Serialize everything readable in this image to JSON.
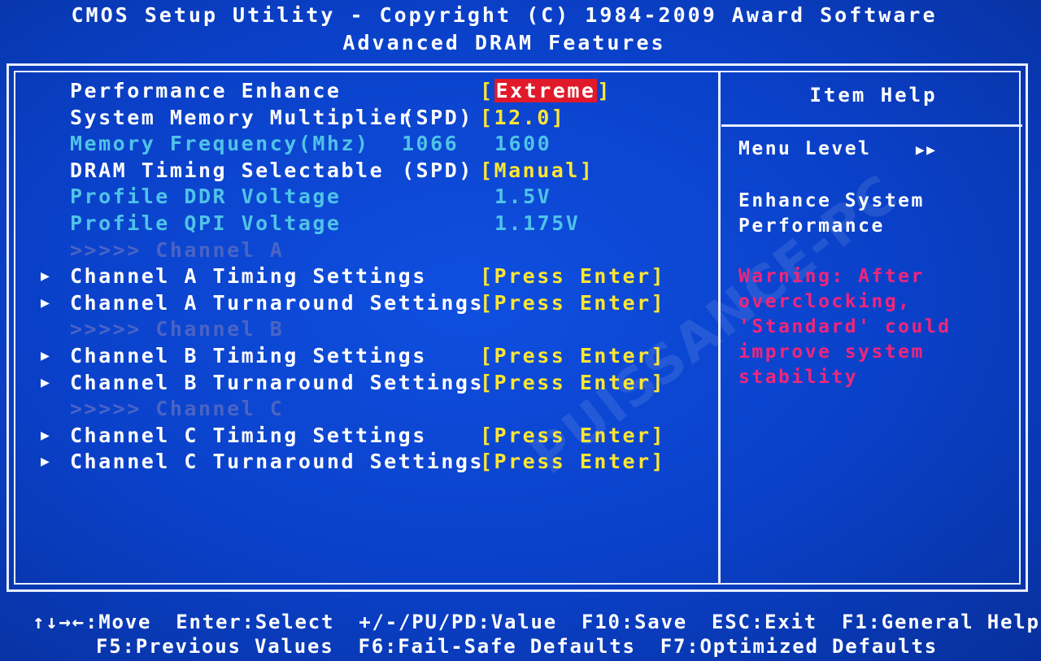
{
  "header": {
    "title": "CMOS Setup Utility - Copyright (C) 1984-2009 Award Software",
    "subtitle": "Advanced DRAM Features"
  },
  "menu": [
    {
      "label": "Performance Enhance",
      "extra": "",
      "value": "[Extreme]",
      "state": "selected"
    },
    {
      "label": "System Memory Multiplier",
      "extra": "(SPD)",
      "value": "[12.0]",
      "state": "normal"
    },
    {
      "label": "Memory Frequency(Mhz)",
      "extra": "1066",
      "value": "1600",
      "state": "info"
    },
    {
      "label": "DRAM Timing Selectable",
      "extra": "(SPD)",
      "value": "[Manual]",
      "state": "normal"
    },
    {
      "label": "Profile DDR Voltage",
      "extra": "",
      "value": "1.5V",
      "state": "info"
    },
    {
      "label": "Profile QPI Voltage",
      "extra": "",
      "value": "1.175V",
      "state": "info"
    },
    {
      "label": ">>>>> Channel A",
      "extra": "",
      "value": "",
      "state": "disabled"
    },
    {
      "label": "Channel A Timing Settings",
      "extra": "",
      "value": "[Press Enter]",
      "state": "submenu"
    },
    {
      "label": "Channel A Turnaround Settings",
      "extra": "",
      "value": "[Press Enter]",
      "state": "submenu"
    },
    {
      "label": ">>>>> Channel B",
      "extra": "",
      "value": "",
      "state": "disabled"
    },
    {
      "label": "Channel B Timing Settings",
      "extra": "",
      "value": "[Press Enter]",
      "state": "submenu"
    },
    {
      "label": "Channel B Turnaround Settings",
      "extra": "",
      "value": "[Press Enter]",
      "state": "submenu"
    },
    {
      "label": ">>>>> Channel C",
      "extra": "",
      "value": "",
      "state": "disabled"
    },
    {
      "label": "Channel C Timing Settings",
      "extra": "",
      "value": "[Press Enter]",
      "state": "submenu"
    },
    {
      "label": "Channel C Turnaround Settings",
      "extra": "",
      "value": "[Press Enter]",
      "state": "submenu"
    }
  ],
  "help": {
    "title": "Item Help",
    "menu_level_label": "Menu Level",
    "menu_level_value": "▶▶",
    "description_lines": [
      "Enhance System",
      "Performance"
    ],
    "warning_lines": [
      "Warning: After",
      "overclocking,",
      "'Standard' could",
      "improve system",
      "stability"
    ]
  },
  "footer": {
    "line1": [
      {
        "key": "↑↓→←",
        "action": ":Move"
      },
      {
        "key": "Enter",
        "action": ":Select"
      },
      {
        "key": "+/-/PU/PD",
        "action": ":Value"
      },
      {
        "key": "F10",
        "action": ":Save"
      },
      {
        "key": "ESC",
        "action": ":Exit"
      },
      {
        "key": "F1",
        "action": ":General Help"
      }
    ],
    "line2": [
      {
        "key": "F5",
        "action": ":Previous Values"
      },
      {
        "key": "F6",
        "action": ":Fail-Safe Defaults"
      },
      {
        "key": "F7",
        "action": ":Optimized Defaults"
      }
    ]
  },
  "watermark": "PUISSANCE-PC",
  "colors": {
    "background": "#0a40c8",
    "value_yellow": "#ffe633",
    "info_cyan": "#4fc3e8",
    "disabled": "#4a64c4",
    "selected_red": "#e0192b",
    "warning_pink": "#f0267a"
  }
}
